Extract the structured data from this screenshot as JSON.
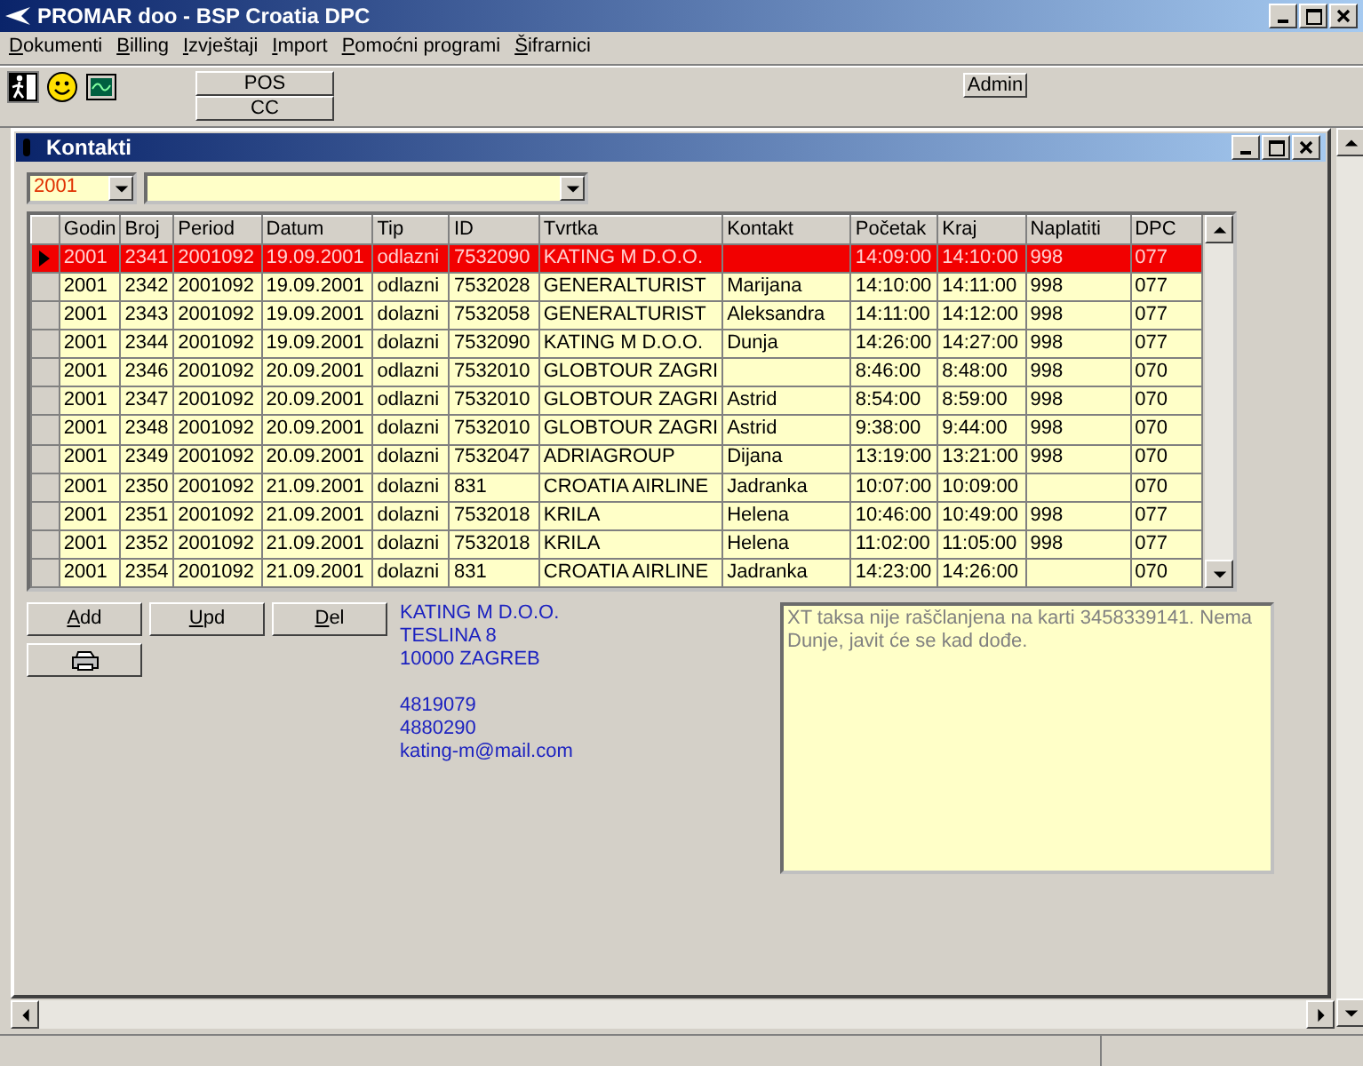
{
  "window": {
    "title": "PROMAR doo - BSP Croatia DPC"
  },
  "menu": [
    "Dokumenti",
    "Billing",
    "Izvještaji",
    "Import",
    "Pomoćni programi",
    "Šifrarnici"
  ],
  "toolbar": {
    "buttons": [
      "POS",
      "CC"
    ],
    "admin": "Admin"
  },
  "child_window": {
    "title": "Kontakti"
  },
  "filters": {
    "year": "2001"
  },
  "table": {
    "columns": [
      "Godin",
      "Broj",
      "Period",
      "Datum",
      "Tip",
      "ID",
      "Tvrtka",
      "Kontakt",
      "Početak",
      "Kraj",
      "Naplatiti",
      "DPC"
    ],
    "rows": [
      {
        "selected": true,
        "cells": [
          "2001",
          "2341",
          "2001092",
          "19.09.2001",
          "odlazni",
          "7532090",
          "KATING M D.O.O.",
          "",
          "14:09:00",
          "14:10:00",
          "998",
          "077"
        ]
      },
      {
        "selected": false,
        "cells": [
          "2001",
          "2342",
          "2001092",
          "19.09.2001",
          "odlazni",
          "7532028",
          "GENERALTURIST",
          "Marijana",
          "14:10:00",
          "14:11:00",
          "998",
          "077"
        ]
      },
      {
        "selected": false,
        "cells": [
          "2001",
          "2343",
          "2001092",
          "19.09.2001",
          "dolazni",
          "7532058",
          "GENERALTURIST",
          "Aleksandra",
          "14:11:00",
          "14:12:00",
          "998",
          "077"
        ]
      },
      {
        "selected": false,
        "cells": [
          "2001",
          "2344",
          "2001092",
          "19.09.2001",
          "dolazni",
          "7532090",
          "KATING M D.O.O.",
          "Dunja",
          "14:26:00",
          "14:27:00",
          "998",
          "077"
        ]
      },
      {
        "selected": false,
        "cells": [
          "2001",
          "2346",
          "2001092",
          "20.09.2001",
          "odlazni",
          "7532010",
          "GLOBTOUR ZAGRI",
          "",
          "8:46:00",
          "8:48:00",
          "998",
          "070"
        ]
      },
      {
        "selected": false,
        "cells": [
          "2001",
          "2347",
          "2001092",
          "20.09.2001",
          "odlazni",
          "7532010",
          "GLOBTOUR ZAGRI",
          "Astrid",
          "8:54:00",
          "8:59:00",
          "998",
          "070"
        ]
      },
      {
        "selected": false,
        "cells": [
          "2001",
          "2348",
          "2001092",
          "20.09.2001",
          "dolazni",
          "7532010",
          "GLOBTOUR ZAGRI",
          "Astrid",
          "9:38:00",
          "9:44:00",
          "998",
          "070"
        ]
      },
      {
        "selected": false,
        "cells": [
          "2001",
          "2349",
          "2001092",
          "20.09.2001",
          "dolazni",
          "7532047",
          "ADRIAGROUP",
          "Dijana",
          "13:19:00",
          "13:21:00",
          "998",
          "070"
        ]
      },
      {
        "selected": false,
        "cells": [
          "2001",
          "2350",
          "2001092",
          "21.09.2001",
          "dolazni",
          "831",
          "CROATIA AIRLINE",
          "Jadranka",
          "10:07:00",
          "10:09:00",
          "",
          "070"
        ]
      },
      {
        "selected": false,
        "cells": [
          "2001",
          "2351",
          "2001092",
          "21.09.2001",
          "dolazni",
          "7532018",
          "KRILA",
          "Helena",
          "10:46:00",
          "10:49:00",
          "998",
          "077"
        ]
      },
      {
        "selected": false,
        "cells": [
          "2001",
          "2352",
          "2001092",
          "21.09.2001",
          "dolazni",
          "7532018",
          "KRILA",
          "Helena",
          "11:02:00",
          "11:05:00",
          "998",
          "077"
        ]
      },
      {
        "selected": false,
        "cells": [
          "2001",
          "2354",
          "2001092",
          "21.09.2001",
          "dolazni",
          "831",
          "CROATIA AIRLINE",
          "Jadranka",
          "14:23:00",
          "14:26:00",
          "",
          "070"
        ]
      }
    ]
  },
  "actions": [
    "Add",
    "Upd",
    "Del"
  ],
  "address": [
    "KATING M D.O.O.",
    "TESLINA 8",
    "10000 ZAGREB"
  ],
  "contacts": [
    "4819079",
    "4880290",
    "kating-m@mail.com"
  ],
  "note": "XT taksa nije raščlanjena na karti 3458339141. Nema Dunje, javit će se kad dođe."
}
